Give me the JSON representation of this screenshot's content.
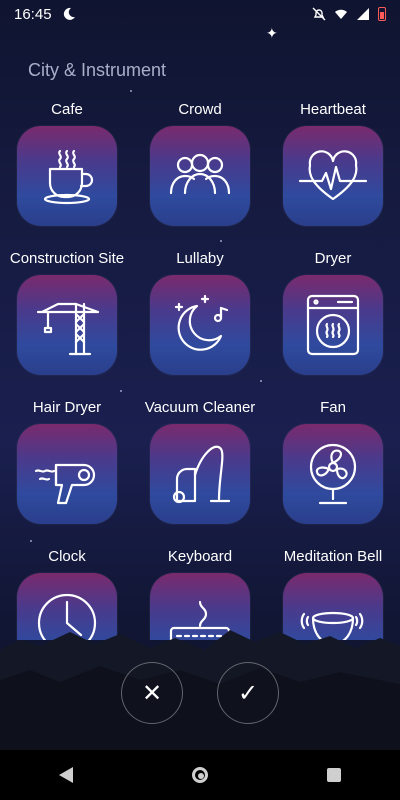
{
  "status_bar": {
    "time": "16:45",
    "icons": [
      "moon-icon",
      "mute-icon",
      "wifi-icon",
      "signal-icon",
      "battery-icon"
    ],
    "battery_color": "#ff5a5a"
  },
  "section": {
    "title": "City & Instrument"
  },
  "sounds": [
    {
      "label": "Cafe",
      "icon": "coffee-cup-icon"
    },
    {
      "label": "Crowd",
      "icon": "people-icon"
    },
    {
      "label": "Heartbeat",
      "icon": "heartbeat-icon"
    },
    {
      "label": "Construction Site",
      "icon": "crane-icon"
    },
    {
      "label": "Lullaby",
      "icon": "moon-stars-icon"
    },
    {
      "label": "Dryer",
      "icon": "dryer-icon"
    },
    {
      "label": "Hair Dryer",
      "icon": "hair-dryer-icon"
    },
    {
      "label": "Vacuum Cleaner",
      "icon": "vacuum-icon"
    },
    {
      "label": "Fan",
      "icon": "fan-icon"
    },
    {
      "label": "Clock",
      "icon": "clock-icon"
    },
    {
      "label": "Keyboard",
      "icon": "keyboard-icon"
    },
    {
      "label": "Meditation Bell",
      "icon": "bell-bowl-icon"
    }
  ],
  "actions": {
    "cancel": "✕",
    "confirm": "✓"
  },
  "colors": {
    "tile_gradient_top": "#7a2a6d",
    "tile_gradient_bottom": "#2a3f8c",
    "section_title": "#a9afc8"
  }
}
